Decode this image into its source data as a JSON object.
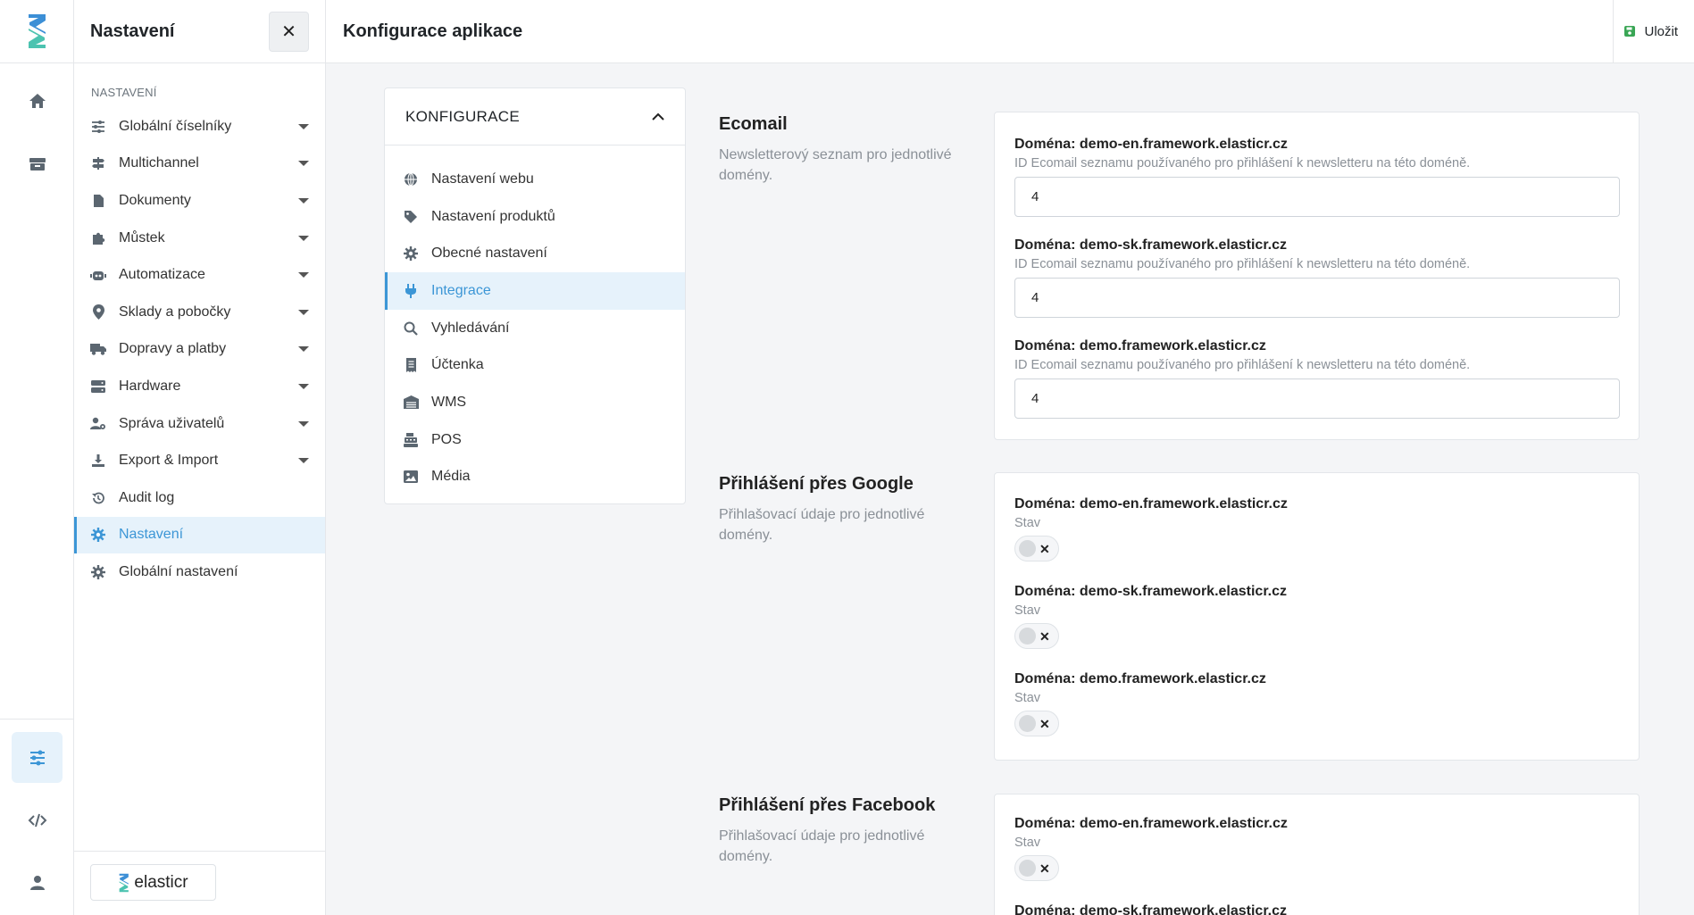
{
  "brand": {
    "name": "elasticr"
  },
  "sidebar": {
    "title": "Nastavení",
    "section_label": "NASTAVENÍ",
    "items": [
      {
        "label": "Globální číselníky",
        "icon": "sliders-icon",
        "has_caret": true
      },
      {
        "label": "Multichannel",
        "icon": "signpost-icon",
        "has_caret": true
      },
      {
        "label": "Dokumenty",
        "icon": "file-icon",
        "has_caret": true
      },
      {
        "label": "Můstek",
        "icon": "puzzle-icon",
        "has_caret": true
      },
      {
        "label": "Automatizace",
        "icon": "robot-icon",
        "has_caret": true
      },
      {
        "label": "Sklady a pobočky",
        "icon": "map-pin-icon",
        "has_caret": true
      },
      {
        "label": "Dopravy a platby",
        "icon": "truck-icon",
        "has_caret": true
      },
      {
        "label": "Hardware",
        "icon": "server-icon",
        "has_caret": true
      },
      {
        "label": "Správa uživatelů",
        "icon": "users-cog-icon",
        "has_caret": true
      },
      {
        "label": "Export & Import",
        "icon": "download-icon",
        "has_caret": true
      },
      {
        "label": "Audit log",
        "icon": "history-icon",
        "has_caret": false
      },
      {
        "label": "Nastavení",
        "icon": "gear-icon",
        "has_caret": false,
        "active": true
      },
      {
        "label": "Globální nastavení",
        "icon": "gear-icon",
        "has_caret": false
      }
    ]
  },
  "topbar": {
    "title": "Konfigurace aplikace",
    "save_label": "Uložit"
  },
  "config_menu": {
    "title": "KONFIGURACE",
    "items": [
      {
        "label": "Nastavení webu",
        "icon": "globe-icon"
      },
      {
        "label": "Nastavení produktů",
        "icon": "tag-icon"
      },
      {
        "label": "Obecné nastavení",
        "icon": "gear-icon"
      },
      {
        "label": "Integrace",
        "icon": "plug-icon",
        "active": true
      },
      {
        "label": "Vyhledávání",
        "icon": "search-icon"
      },
      {
        "label": "Účtenka",
        "icon": "receipt-icon"
      },
      {
        "label": "WMS",
        "icon": "warehouse-icon"
      },
      {
        "label": "POS",
        "icon": "cash-register-icon"
      },
      {
        "label": "Média",
        "icon": "image-icon"
      }
    ]
  },
  "sections": {
    "ecomail": {
      "title": "Ecomail",
      "description": "Newsletterový seznam pro jednotlivé domény.",
      "fields": [
        {
          "label": "Doména: demo-en.framework.elasticr.cz",
          "hint": "ID Ecomail seznamu používaného pro přihlášení k newsletteru na této doméně.",
          "value": "4"
        },
        {
          "label": "Doména: demo-sk.framework.elasticr.cz",
          "hint": "ID Ecomail seznamu používaného pro přihlášení k newsletteru na této doméně.",
          "value": "4"
        },
        {
          "label": "Doména: demo.framework.elasticr.cz",
          "hint": "ID Ecomail seznamu používaného pro přihlášení k newsletteru na této doméně.",
          "value": "4"
        }
      ]
    },
    "google": {
      "title": "Přihlášení přes Google",
      "description": "Přihlašovací údaje pro jednotlivé domény.",
      "fields": [
        {
          "label": "Doména: demo-en.framework.elasticr.cz",
          "state_label": "Stav",
          "enabled": false
        },
        {
          "label": "Doména: demo-sk.framework.elasticr.cz",
          "state_label": "Stav",
          "enabled": false
        },
        {
          "label": "Doména: demo.framework.elasticr.cz",
          "state_label": "Stav",
          "enabled": false
        }
      ]
    },
    "facebook": {
      "title": "Přihlášení přes Facebook",
      "description": "Přihlašovací údaje pro jednotlivé domény.",
      "fields": [
        {
          "label": "Doména: demo-en.framework.elasticr.cz",
          "state_label": "Stav",
          "enabled": false
        },
        {
          "label": "Doména: demo-sk.framework.elasticr.cz"
        }
      ]
    }
  },
  "colors": {
    "accent": "#3c96d6",
    "active_bg": "#e6f2fb",
    "logo_teal": "#4cc3b0",
    "logo_blue": "#3c8fd6",
    "save_green": "#3aa655"
  }
}
